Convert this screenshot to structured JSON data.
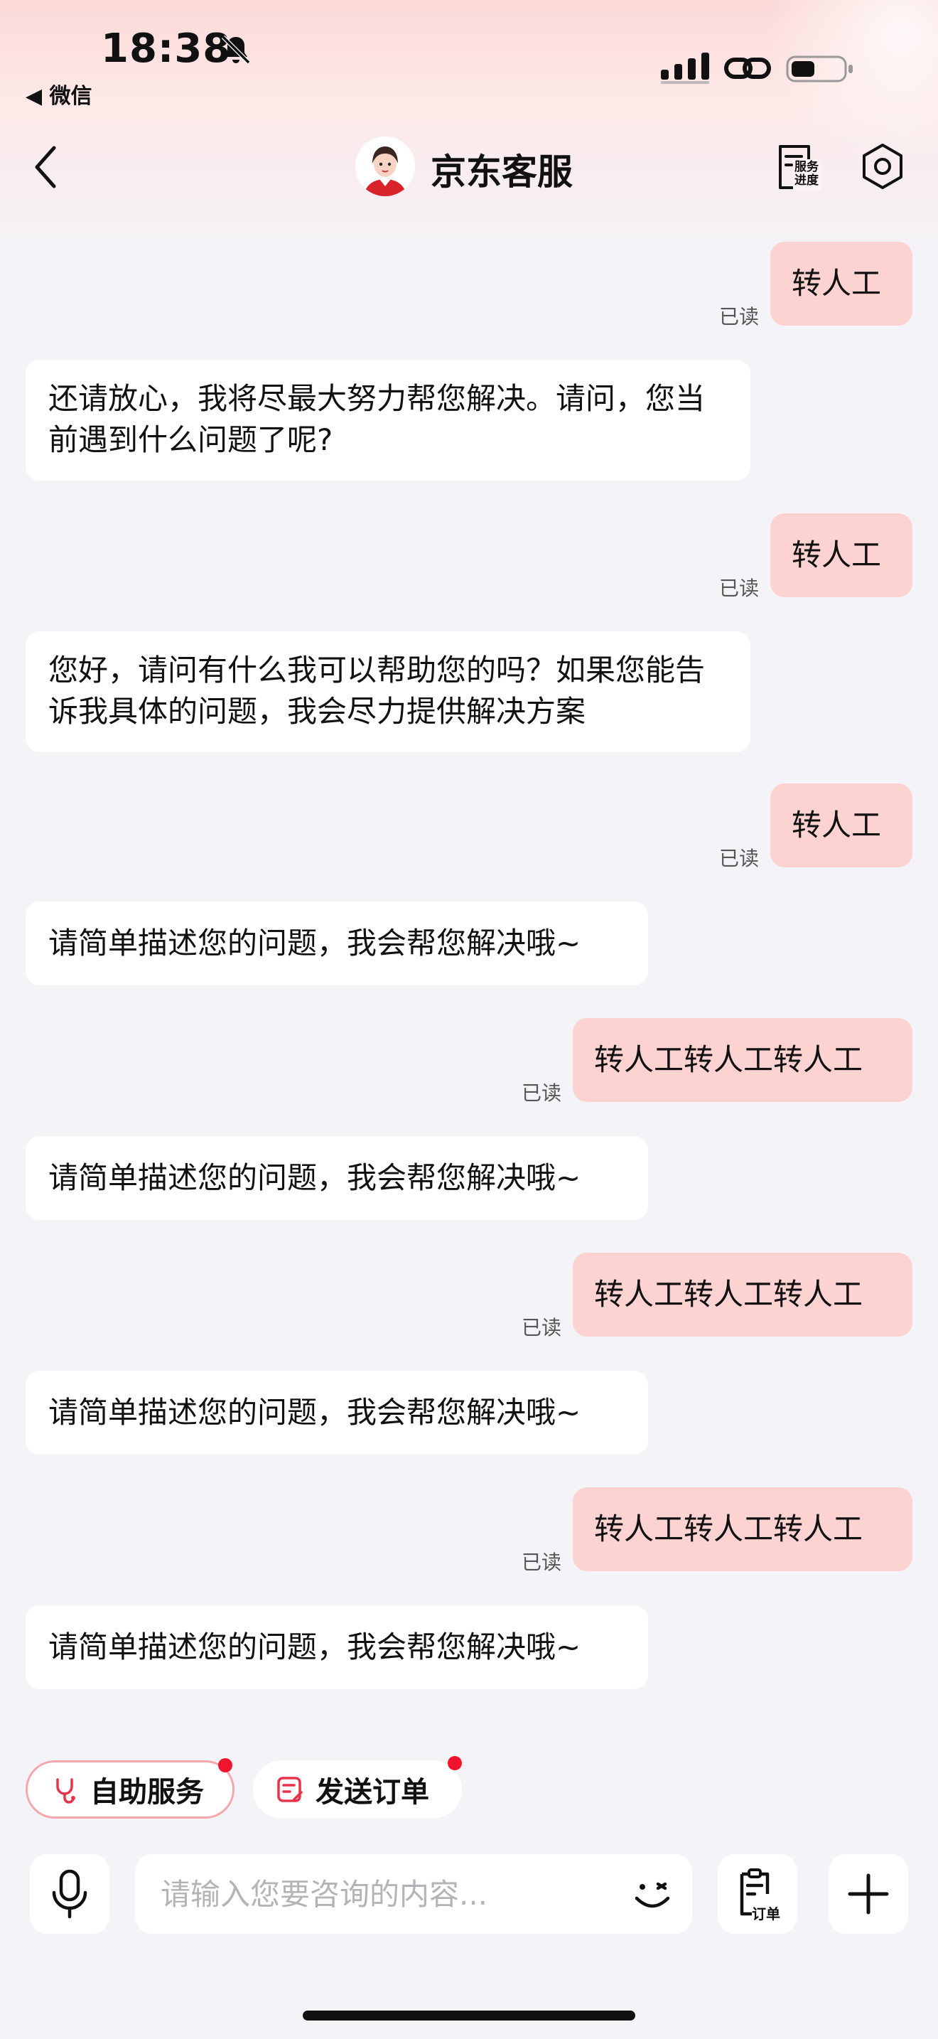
{
  "status_bar": {
    "time": "18:38",
    "back_app": "◀ 微信"
  },
  "nav": {
    "title": "京东客服",
    "progress_label_line1": "服务",
    "progress_label_line2": "进度"
  },
  "messages": [
    {
      "side": "me",
      "text": "转人工",
      "status": "已读"
    },
    {
      "side": "bot",
      "text": "还请放心，我将尽最大努力帮您解决。请问，您当前遇到什么问题了呢?"
    },
    {
      "side": "me",
      "text": "转人工",
      "status": "已读"
    },
    {
      "side": "bot",
      "text": "您好，请问有什么我可以帮助您的吗？如果您能告诉我具体的问题，我会尽力提供解决方案"
    },
    {
      "side": "me",
      "text": "转人工",
      "status": "已读"
    },
    {
      "side": "bot",
      "text": "请简单描述您的问题，我会帮您解决哦~"
    },
    {
      "side": "me",
      "text": "转人工转人工转人工",
      "status": "已读"
    },
    {
      "side": "bot",
      "text": "请简单描述您的问题，我会帮您解决哦~"
    },
    {
      "side": "me",
      "text": "转人工转人工转人工",
      "status": "已读"
    },
    {
      "side": "bot",
      "text": "请简单描述您的问题，我会帮您解决哦~"
    },
    {
      "side": "me",
      "text": "转人工转人工转人工",
      "status": "已读"
    },
    {
      "side": "bot",
      "text": "请简单描述您的问题，我会帮您解决哦~"
    }
  ],
  "quick_actions": {
    "self_service": "自助服务",
    "send_order": "发送订单"
  },
  "input": {
    "placeholder": "请输入您要咨询的内容...",
    "order_label": "订单"
  },
  "colors": {
    "my_bubble": "#fdd3d1",
    "bot_bubble": "#ffffff",
    "accent_red": "#f0142c"
  },
  "icons": [
    "bell-off-icon",
    "signal-icon",
    "link-icon",
    "battery-icon",
    "back-arrow-icon",
    "service-progress-icon",
    "settings-icon",
    "self-service-icon",
    "send-order-icon",
    "microphone-icon",
    "emoji-icon",
    "order-icon",
    "plus-icon"
  ]
}
